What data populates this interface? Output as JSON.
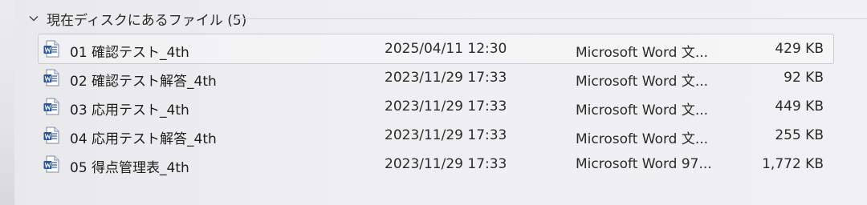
{
  "group": {
    "label": "現在ディスクにあるファイル (5)"
  },
  "files": [
    {
      "name": "01 確認テスト_4th",
      "date": "2025/04/11 12:30",
      "type": "Microsoft Word 文...",
      "size": "429 KB",
      "icon": "word-doc-icon"
    },
    {
      "name": "02 確認テスト解答_4th",
      "date": "2023/11/29 17:33",
      "type": "Microsoft Word 文...",
      "size": "92 KB",
      "icon": "word-doc-icon"
    },
    {
      "name": "03 応用テスト_4th",
      "date": "2023/11/29 17:33",
      "type": "Microsoft Word 文...",
      "size": "449 KB",
      "icon": "word-doc-icon"
    },
    {
      "name": "04 応用テスト解答_4th",
      "date": "2023/11/29 17:33",
      "type": "Microsoft Word 文...",
      "size": "255 KB",
      "icon": "word-doc-icon"
    },
    {
      "name": "05 得点管理表_4th",
      "date": "2023/11/29 17:33",
      "type": "Microsoft Word 97...",
      "size": "1,772 KB",
      "icon": "word-doc-icon"
    }
  ],
  "colors": {
    "word_blue": "#2b579a",
    "selection_border": "#c9cbd3"
  }
}
